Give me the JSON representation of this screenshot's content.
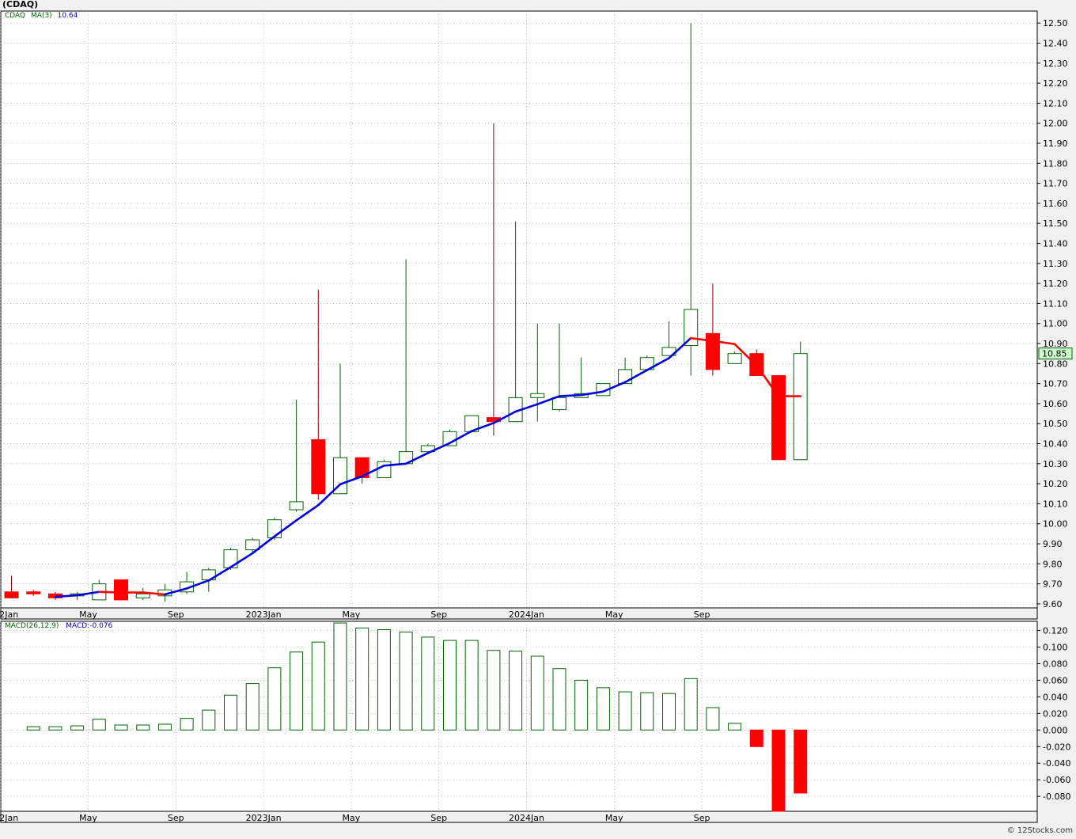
{
  "ticker": "(CDAQ)",
  "price_legend": {
    "symbol": "CDAQ",
    "ma_label": "MA(3)",
    "ma_value": "10.64"
  },
  "macd_legend": {
    "label": "MACD(26,12,9)",
    "value_label": "MACD:-0.076"
  },
  "last_price_label": "10.85",
  "watermark": "© 12Stocks.com",
  "colors": {
    "up": "#006400",
    "down": "#ff0000",
    "ma_up": "#0000dd",
    "ma_down": "#ff0000",
    "grid": "#999999",
    "background": "#ffffff",
    "page": "#f0f0f0",
    "legend_symbol": "#006400",
    "legend_ma": "#0000cc",
    "last_price_bg": "#ccffcc"
  },
  "chart_data": [
    {
      "type": "candlestick",
      "xlabel": "",
      "ylabel": "",
      "ylim": [
        9.58,
        12.56
      ],
      "yticks": [
        "9.60",
        "9.70",
        "9.80",
        "9.90",
        "10.00",
        "10.10",
        "10.20",
        "10.30",
        "10.40",
        "10.50",
        "10.60",
        "10.70",
        "10.80",
        "10.90",
        "11.00",
        "11.10",
        "11.20",
        "11.30",
        "11.40",
        "11.50",
        "11.60",
        "11.70",
        "11.80",
        "11.90",
        "12.00",
        "12.10",
        "12.20",
        "12.30",
        "12.40",
        "12.50"
      ],
      "xticks": [
        "2022Jan",
        "May",
        "Sep",
        "2023Jan",
        "May",
        "Sep",
        "2024Jan",
        "May",
        "Sep"
      ],
      "xtick_month_index": [
        0,
        4,
        8,
        12,
        16,
        20,
        24,
        28,
        32
      ],
      "candles": [
        {
          "m": "2022-01",
          "o": 9.66,
          "h": 9.74,
          "l": 9.63,
          "c": 9.63
        },
        {
          "m": "2022-02",
          "o": 9.66,
          "h": 9.67,
          "l": 9.64,
          "c": 9.65
        },
        {
          "m": "2022-03",
          "o": 9.65,
          "h": 9.66,
          "l": 9.62,
          "c": 9.63
        },
        {
          "m": "2022-04",
          "o": 9.64,
          "h": 9.66,
          "l": 9.62,
          "c": 9.65
        },
        {
          "m": "2022-05",
          "o": 9.62,
          "h": 9.72,
          "l": 9.62,
          "c": 9.7
        },
        {
          "m": "2022-06",
          "o": 9.72,
          "h": 9.72,
          "l": 9.62,
          "c": 9.62
        },
        {
          "m": "2022-07",
          "o": 9.63,
          "h": 9.68,
          "l": 9.62,
          "c": 9.65
        },
        {
          "m": "2022-08",
          "o": 9.64,
          "h": 9.7,
          "l": 9.61,
          "c": 9.67
        },
        {
          "m": "2022-09",
          "o": 9.66,
          "h": 9.76,
          "l": 9.65,
          "c": 9.71
        },
        {
          "m": "2022-10",
          "o": 9.72,
          "h": 9.78,
          "l": 9.66,
          "c": 9.77
        },
        {
          "m": "2022-11",
          "o": 9.78,
          "h": 9.88,
          "l": 9.77,
          "c": 9.87
        },
        {
          "m": "2022-12",
          "o": 9.87,
          "h": 9.93,
          "l": 9.86,
          "c": 9.92
        },
        {
          "m": "2023-01",
          "o": 9.93,
          "h": 10.03,
          "l": 9.92,
          "c": 10.02
        },
        {
          "m": "2023-02",
          "o": 10.07,
          "h": 10.62,
          "l": 10.06,
          "c": 10.11
        },
        {
          "m": "2023-03",
          "o": 10.42,
          "h": 11.17,
          "l": 10.12,
          "c": 10.15
        },
        {
          "m": "2023-04",
          "o": 10.15,
          "h": 10.8,
          "l": 10.15,
          "c": 10.33
        },
        {
          "m": "2023-05",
          "o": 10.33,
          "h": 10.33,
          "l": 10.2,
          "c": 10.23
        },
        {
          "m": "2023-06",
          "o": 10.23,
          "h": 10.32,
          "l": 10.23,
          "c": 10.31
        },
        {
          "m": "2023-07",
          "o": 10.3,
          "h": 11.32,
          "l": 10.3,
          "c": 10.36
        },
        {
          "m": "2023-08",
          "o": 10.36,
          "h": 10.4,
          "l": 10.36,
          "c": 10.39
        },
        {
          "m": "2023-09",
          "o": 10.39,
          "h": 10.47,
          "l": 10.39,
          "c": 10.46
        },
        {
          "m": "2023-10",
          "o": 10.46,
          "h": 10.54,
          "l": 10.46,
          "c": 10.54
        },
        {
          "m": "2023-11",
          "o": 10.53,
          "h": 12.0,
          "l": 10.44,
          "c": 10.51
        },
        {
          "m": "2023-12",
          "o": 10.51,
          "h": 11.51,
          "l": 10.51,
          "c": 10.63
        },
        {
          "m": "2024-01",
          "o": 10.63,
          "h": 11.0,
          "l": 10.51,
          "c": 10.65
        },
        {
          "m": "2024-02",
          "o": 10.57,
          "h": 11.0,
          "l": 10.56,
          "c": 10.63
        },
        {
          "m": "2024-03",
          "o": 10.63,
          "h": 10.83,
          "l": 10.63,
          "c": 10.65
        },
        {
          "m": "2024-04",
          "o": 10.64,
          "h": 10.7,
          "l": 10.64,
          "c": 10.7
        },
        {
          "m": "2024-05",
          "o": 10.7,
          "h": 10.83,
          "l": 10.7,
          "c": 10.77
        },
        {
          "m": "2024-06",
          "o": 10.77,
          "h": 10.84,
          "l": 10.77,
          "c": 10.83
        },
        {
          "m": "2024-07",
          "o": 10.84,
          "h": 11.01,
          "l": 10.84,
          "c": 10.88
        },
        {
          "m": "2024-08",
          "o": 10.89,
          "h": 12.5,
          "l": 10.74,
          "c": 11.07
        },
        {
          "m": "2024-09",
          "o": 10.95,
          "h": 11.2,
          "l": 10.74,
          "c": 10.77
        },
        {
          "m": "2024-10",
          "o": 10.8,
          "h": 10.86,
          "l": 10.8,
          "c": 10.85
        },
        {
          "m": "2024-11",
          "o": 10.85,
          "h": 10.87,
          "l": 10.74,
          "c": 10.74
        },
        {
          "m": "2024-12",
          "o": 10.74,
          "h": 10.74,
          "l": 10.32,
          "c": 10.32
        },
        {
          "m": "2025-01",
          "o": 10.32,
          "h": 10.91,
          "l": 10.32,
          "c": 10.85
        }
      ],
      "ma": [
        {
          "i": 2,
          "v": 9.635,
          "trend": "up"
        },
        {
          "i": 3,
          "v": 9.643,
          "trend": "up"
        },
        {
          "i": 4,
          "v": 9.66,
          "trend": "up"
        },
        {
          "i": 5,
          "v": 9.657,
          "trend": "down"
        },
        {
          "i": 6,
          "v": 9.657,
          "trend": "down"
        },
        {
          "i": 7,
          "v": 9.647,
          "trend": "down"
        },
        {
          "i": 8,
          "v": 9.677,
          "trend": "up"
        },
        {
          "i": 9,
          "v": 9.717,
          "trend": "up"
        },
        {
          "i": 10,
          "v": 9.783,
          "trend": "up"
        },
        {
          "i": 11,
          "v": 9.853,
          "trend": "up"
        },
        {
          "i": 12,
          "v": 9.937,
          "trend": "up"
        },
        {
          "i": 13,
          "v": 10.017,
          "trend": "up"
        },
        {
          "i": 14,
          "v": 10.093,
          "trend": "up"
        },
        {
          "i": 15,
          "v": 10.197,
          "trend": "up"
        },
        {
          "i": 16,
          "v": 10.237,
          "trend": "up"
        },
        {
          "i": 17,
          "v": 10.29,
          "trend": "up"
        },
        {
          "i": 18,
          "v": 10.3,
          "trend": "up"
        },
        {
          "i": 19,
          "v": 10.353,
          "trend": "up"
        },
        {
          "i": 20,
          "v": 10.403,
          "trend": "up"
        },
        {
          "i": 21,
          "v": 10.463,
          "trend": "up"
        },
        {
          "i": 22,
          "v": 10.503,
          "trend": "up"
        },
        {
          "i": 23,
          "v": 10.56,
          "trend": "up"
        },
        {
          "i": 24,
          "v": 10.597,
          "trend": "up"
        },
        {
          "i": 25,
          "v": 10.637,
          "trend": "up"
        },
        {
          "i": 26,
          "v": 10.643,
          "trend": "up"
        },
        {
          "i": 27,
          "v": 10.66,
          "trend": "up"
        },
        {
          "i": 28,
          "v": 10.707,
          "trend": "up"
        },
        {
          "i": 29,
          "v": 10.767,
          "trend": "up"
        },
        {
          "i": 30,
          "v": 10.827,
          "trend": "up"
        },
        {
          "i": 31,
          "v": 10.927,
          "trend": "up"
        },
        {
          "i": 32,
          "v": 10.913,
          "trend": "down"
        },
        {
          "i": 33,
          "v": 10.897,
          "trend": "down"
        },
        {
          "i": 34,
          "v": 10.79,
          "trend": "down"
        },
        {
          "i": 35,
          "v": 10.637,
          "trend": "down"
        },
        {
          "i": 36,
          "v": 10.637,
          "trend": "down"
        }
      ]
    },
    {
      "type": "bar",
      "title": "MACD(26,12,9)",
      "ylim": [
        -0.098,
        0.131
      ],
      "yticks": [
        "-0.080",
        "-0.060",
        "-0.040",
        "-0.020",
        "0.000",
        "0.020",
        "0.040",
        "0.060",
        "0.080",
        "0.100",
        "0.120"
      ],
      "xticks": [
        "2022Jan",
        "May",
        "Sep",
        "2023Jan",
        "May",
        "Sep",
        "2024Jan",
        "May",
        "Sep"
      ],
      "xtick_month_index": [
        0,
        4,
        8,
        12,
        16,
        20,
        24,
        28,
        32
      ],
      "values": [
        null,
        0.004,
        0.004,
        0.005,
        0.013,
        0.006,
        0.006,
        0.007,
        0.014,
        0.024,
        0.042,
        0.056,
        0.075,
        0.094,
        0.106,
        0.129,
        0.123,
        0.121,
        0.118,
        0.112,
        0.108,
        0.108,
        0.096,
        0.095,
        0.089,
        0.074,
        0.06,
        0.051,
        0.046,
        0.045,
        0.044,
        0.062,
        0.027,
        0.008,
        -0.02,
        -0.098,
        -0.076
      ]
    }
  ]
}
